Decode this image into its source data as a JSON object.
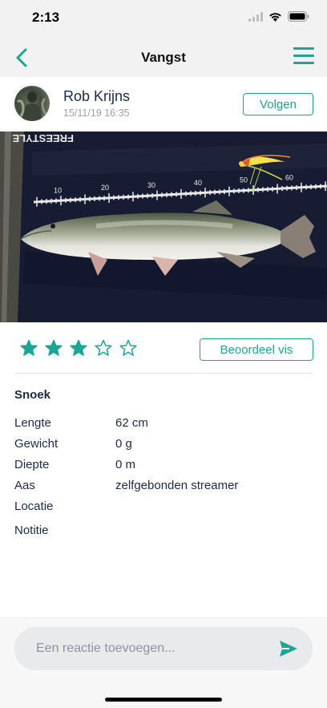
{
  "status_bar": {
    "time": "2:13",
    "icons": [
      "signal-icon",
      "wifi-icon",
      "battery-icon"
    ]
  },
  "nav": {
    "title": "Vangst",
    "back_icon": "chevron-left-icon",
    "menu_icon": "hamburger-menu-icon",
    "accent": "#1aa595"
  },
  "user": {
    "name": "Rob Krijns",
    "date": "15/11/19 16:35",
    "follow_label": "Volgen"
  },
  "photo": {
    "ruler_labels": [
      "10",
      "20",
      "30",
      "40",
      "50",
      "60"
    ],
    "mat_text": "FREESTYLE"
  },
  "rating": {
    "value": 3,
    "max": 5,
    "button_label": "Beoordeel vis"
  },
  "catch": {
    "species": "Snoek",
    "details": [
      {
        "label": "Lengte",
        "value": "62 cm"
      },
      {
        "label": "Gewicht",
        "value": "0 g"
      },
      {
        "label": "Diepte",
        "value": "0 m"
      },
      {
        "label": "Aas",
        "value": "zelfgebonden streamer"
      },
      {
        "label": "Locatie",
        "value": ""
      }
    ],
    "note_label": "Notitie"
  },
  "comment": {
    "placeholder": "Een reactie toevoegen...",
    "send_icon": "send-icon"
  },
  "colors": {
    "accent": "#1aa595",
    "text": "#1d2a4a",
    "muted": "#9aa0ab"
  }
}
